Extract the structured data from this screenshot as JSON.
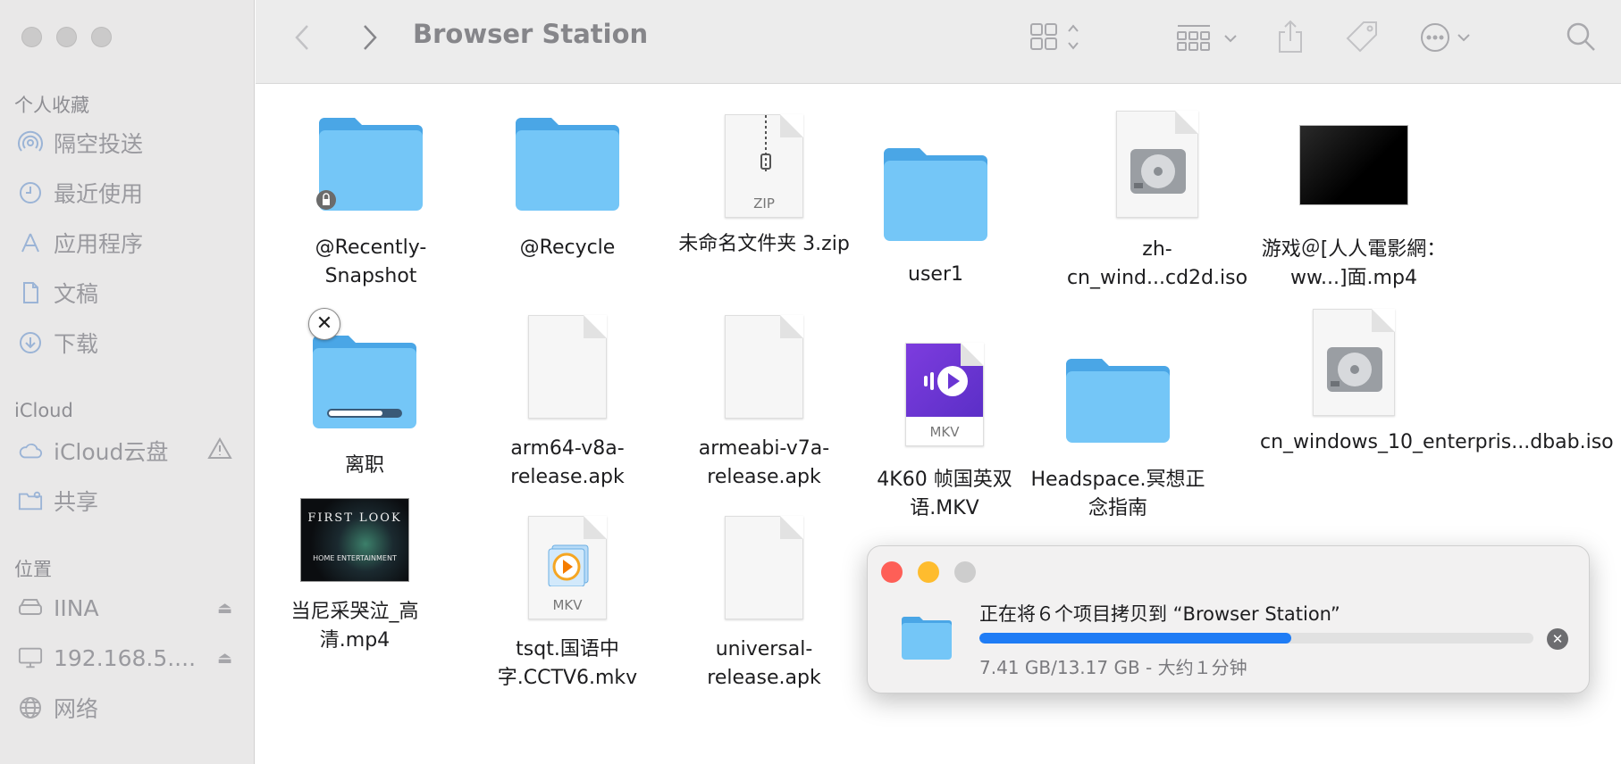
{
  "window": {
    "title": "Browser Station"
  },
  "sidebar": {
    "favorites_header": "个人收藏",
    "favorites": [
      {
        "label": "隔空投送",
        "icon": "airdrop-icon"
      },
      {
        "label": "最近使用",
        "icon": "clock-icon"
      },
      {
        "label": "应用程序",
        "icon": "applications-icon"
      },
      {
        "label": "文稿",
        "icon": "document-icon"
      },
      {
        "label": "下载",
        "icon": "download-icon"
      }
    ],
    "icloud_header": "iCloud",
    "icloud": [
      {
        "label": "iCloud云盘",
        "icon": "cloud-icon"
      },
      {
        "label": "共享",
        "icon": "shared-folder-icon"
      }
    ],
    "locations_header": "位置",
    "locations": [
      {
        "label": "IINA",
        "icon": "drive-icon"
      },
      {
        "label": "192.168.5....",
        "icon": "display-icon"
      },
      {
        "label": "网络",
        "icon": "network-icon"
      }
    ]
  },
  "files": [
    {
      "name": "@Recently-Snapshot",
      "kind": "folder-locked"
    },
    {
      "name": "@Recycle",
      "kind": "folder"
    },
    {
      "name": "未命名文件夹 3.zip",
      "kind": "zip",
      "badge": "ZIP"
    },
    {
      "name": "user1",
      "kind": "folder"
    },
    {
      "name": "zh-cn_wind...cd2d.iso",
      "kind": "disk-image"
    },
    {
      "name": "游戏＠[人人電影網：ww...]面.mp4",
      "kind": "video-black"
    },
    {
      "name": "离职",
      "kind": "folder-copying",
      "copy_progress": 0.75
    },
    {
      "name": "arm64-v8a-release.apk",
      "kind": "document"
    },
    {
      "name": "armeabi-v7a-release.apk",
      "kind": "document"
    },
    {
      "name": "4K60 帧国英双语.MKV",
      "kind": "mkv-purple",
      "badge": "MKV"
    },
    {
      "name": "Headspace.冥想正念指南",
      "kind": "folder"
    },
    {
      "name": "cn_windows_10_enterpris...dbab.iso",
      "kind": "disk-image"
    },
    {
      "name": "当尼采哭泣_高清.mp4",
      "kind": "video-poster",
      "poster_line1": "FIRST LOOK",
      "poster_line2": "HOME ENTERTAINMENT"
    },
    {
      "name": "tsqt.国语中字.CCTV6.mkv",
      "kind": "mkv-player",
      "badge": "MKV"
    },
    {
      "name": "universal-release.apk",
      "kind": "document"
    }
  ],
  "copy_dialog": {
    "title": "正在将６个项目拷贝到 “Browser Station”",
    "status": "7.41 GB/13.17 GB - 大约１分钟",
    "progress": 0.5627,
    "colors": {
      "close": "#fe5f57",
      "minimize": "#febc2e",
      "zoom": "#cdcdcd",
      "progress": "#1f7cf5"
    }
  }
}
